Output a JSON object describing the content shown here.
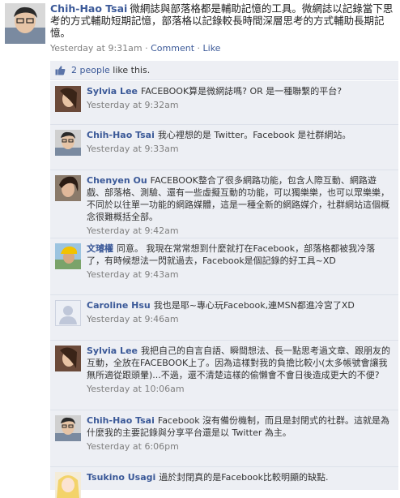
{
  "post": {
    "author": "Chih-Hao Tsai",
    "text": "微網誌與部落格都是輔助記憶的工具。微網誌以記錄當下思考的方式輔助短期記憶，部落格以記錄較長時間深層思考的方式輔助長期記憶。",
    "timestamp": "Yesterday at 9:31am",
    "separator": " · ",
    "comment_link": "Comment",
    "like_link": "Like"
  },
  "likes": {
    "count_link": "2 people",
    "suffix": " like this."
  },
  "comments": [
    {
      "author": "Sylvia Lee",
      "text": "FACEBOOK算是微網誌嗎? OR 是一種聯繫的平台?",
      "time": "Yesterday at 9:32am"
    },
    {
      "author": "Chih-Hao Tsai",
      "text": "我心裡想的是 Twitter。Facebook 是社群網站。",
      "time": "Yesterday at 9:33am"
    },
    {
      "author": "Chenyen Ou",
      "text": "FACEBOOK整合了很多網路功能，包含人際互動、網路遊戲、部落格、測驗、還有一些虛擬互動的功能，可以獨樂樂，也可以眾樂樂，不同於以往單一功能的網路媒體，這是一種全新的網路媒介，社群網站這個概念很難概括全部。",
      "time": "Yesterday at 9:42am"
    },
    {
      "author": "文璿權",
      "text": "同意。 我現在常常想到什麼就打在Facebook，部落格都被我冷落了，有時候想法一閃就過去，Facebook是個記錄的好工具~XD",
      "time": "Yesterday at 9:43am"
    },
    {
      "author": "Caroline Hsu",
      "text": "我也是耶~專心玩Facebook,連MSN都進冷宮了XD",
      "time": "Yesterday at 9:46am"
    },
    {
      "author": "Sylvia Lee",
      "text": "我把自己的自言自語、瞬間想法、長一點思考過文章、跟朋友的互動，全放在FACEBOOK上了。因為這樣對我的負擔比較小(太多帳號會讓我無所適從跟頭暈)...不過，還不清楚這樣的偷懶會不會日後造成更大的不便?",
      "time": "Yesterday at 10:06am"
    },
    {
      "author": "Chih-Hao Tsai",
      "text": "Facebook 沒有備份機制，而且是封閉式的社群。這就是為什麼我的主要記錄與分享平台還是以 Twitter 為主。",
      "time": "Yesterday at 6:06pm"
    },
    {
      "author": "Tsukino Usagi",
      "text": "過於封閉真的是Facebook比較明顯的缺點.",
      "time": ""
    }
  ],
  "colors": {
    "link": "#3b5998",
    "comment_bg": "#edeff4",
    "meta": "#808080"
  }
}
